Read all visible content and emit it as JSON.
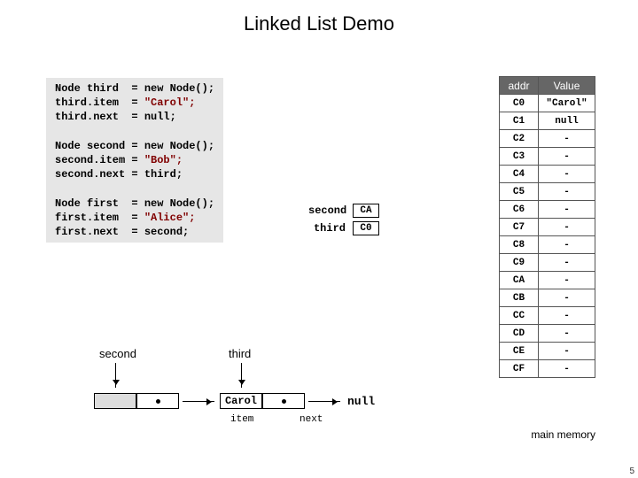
{
  "title": "Linked List Demo",
  "code": {
    "l1": "Node third  = new Node();",
    "l2_lhs": "third.item  = ",
    "l2_rhs": "\"Carol\";",
    "l3": "third.next  = null;",
    "l4": "Node second = new Node();",
    "l5_lhs": "second.item = ",
    "l5_rhs": "\"Bob\";",
    "l6": "second.next = third;",
    "l7": "Node first  = new Node();",
    "l8_lhs": "first.item  = ",
    "l8_rhs": "\"Alice\";",
    "l9": "first.next  = second;"
  },
  "pointers": {
    "second": {
      "label": "second",
      "addr": "CA"
    },
    "third": {
      "label": "third",
      "addr": "C0"
    }
  },
  "memory": {
    "headers": {
      "addr": "addr",
      "value": "Value"
    },
    "rows": [
      {
        "addr": "C0",
        "value": "\"Carol\""
      },
      {
        "addr": "C1",
        "value": "null"
      },
      {
        "addr": "C2",
        "value": "-"
      },
      {
        "addr": "C3",
        "value": "-"
      },
      {
        "addr": "C4",
        "value": "-"
      },
      {
        "addr": "C5",
        "value": "-"
      },
      {
        "addr": "C6",
        "value": "-"
      },
      {
        "addr": "C7",
        "value": "-"
      },
      {
        "addr": "C8",
        "value": "-"
      },
      {
        "addr": "C9",
        "value": "-"
      },
      {
        "addr": "CA",
        "value": "-"
      },
      {
        "addr": "CB",
        "value": "-"
      },
      {
        "addr": "CC",
        "value": "-"
      },
      {
        "addr": "CD",
        "value": "-"
      },
      {
        "addr": "CE",
        "value": "-"
      },
      {
        "addr": "CF",
        "value": "-"
      }
    ],
    "caption": "main memory"
  },
  "diagram": {
    "second_label": "second",
    "third_label": "third",
    "third_item": "Carol",
    "null_label": "null",
    "item_caption": "item",
    "next_caption": "next"
  },
  "pagenum": "5"
}
